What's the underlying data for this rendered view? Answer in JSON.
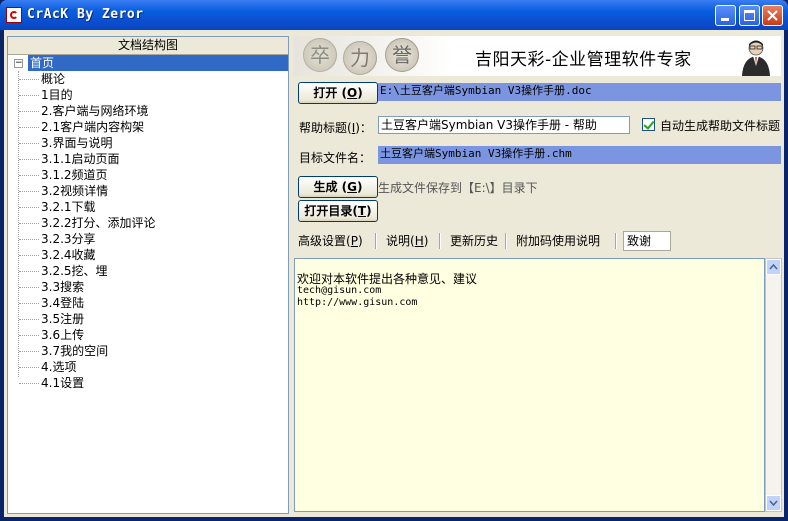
{
  "window": {
    "title": "CrAcK By Zeror"
  },
  "tree": {
    "header": "文档结构图",
    "root": "首页",
    "items": [
      "概论",
      "1目的",
      "2.客户端与网络环境",
      "2.1客户端内容构架",
      "3.界面与说明",
      "3.1.1启动页面",
      "3.1.2频道页",
      "3.2视频详情",
      "3.2.1下载",
      "3.2.2打分、添加评论",
      "3.2.3分享",
      "3.2.4收藏",
      "3.2.5挖、埋",
      "3.3搜索",
      "3.4登陆",
      "3.5注册",
      "3.6上传",
      "3.7我的空间",
      "4.选项",
      "4.1设置"
    ]
  },
  "banner": {
    "text": "吉阳天彩-企业管理软件专家",
    "chess_glyphs": [
      "卒",
      "力",
      "誉"
    ]
  },
  "form": {
    "open_button": "打开",
    "open_mnemonic": "O",
    "source_path": "E:\\土豆客户端Symbian V3操作手册.doc",
    "help_title_label": "帮助标题",
    "help_title_mnemonic": "I",
    "help_title_value": "土豆客户端Symbian V3操作手册 - 帮助",
    "auto_title_checkbox": "自动生成帮助文件标题",
    "auto_title_checked": true,
    "target_name_label": "目标文件名：",
    "target_name_value": "土豆客户端Symbian V3操作手册.chm",
    "generate_button": "生成",
    "generate_mnemonic": "G",
    "save_hint": "生成文件保存到【E:\\】目录下",
    "open_dir_button": "打开目录",
    "open_dir_mnemonic": "T"
  },
  "tabs": [
    {
      "label": "高级设置",
      "mnemonic": "P"
    },
    {
      "label": "说明",
      "mnemonic": "H"
    },
    {
      "label": "更新历史",
      "mnemonic": ""
    },
    {
      "label": "附加码使用说明",
      "mnemonic": ""
    },
    {
      "label": "致谢",
      "mnemonic": ""
    }
  ],
  "active_tab": "致谢",
  "content": {
    "lines": [
      "欢迎对本软件提出各种意见、建议",
      "tech@gisun.com",
      "http://www.gisun.com"
    ]
  },
  "colors": {
    "selection": "#316ac5",
    "path_highlight": "#7b95e0",
    "content_bg": "#ffffe1",
    "window_face": "#ece9d8"
  },
  "icons": [
    "app-icon",
    "minimize-icon",
    "maximize-icon",
    "close-icon",
    "collapse-icon",
    "checkmark-icon",
    "scroll-up-icon",
    "scroll-down-icon"
  ]
}
